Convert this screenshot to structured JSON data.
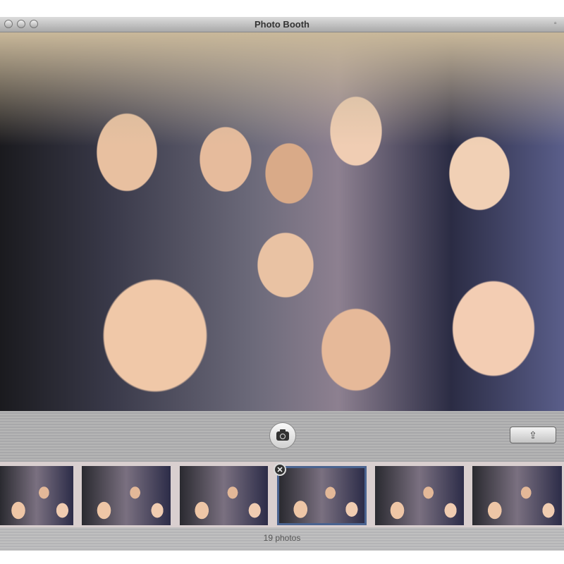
{
  "window": {
    "title": "Photo Booth"
  },
  "toolbar": {
    "take_photo_icon": "camera-icon",
    "share_icon": "share-arrow-icon",
    "share_glyph": "⇪"
  },
  "filmstrip": {
    "thumbnail_count_visible": 6,
    "selected_index": 3,
    "delete_glyph": "✕"
  },
  "footer": {
    "status": "19 photos"
  }
}
